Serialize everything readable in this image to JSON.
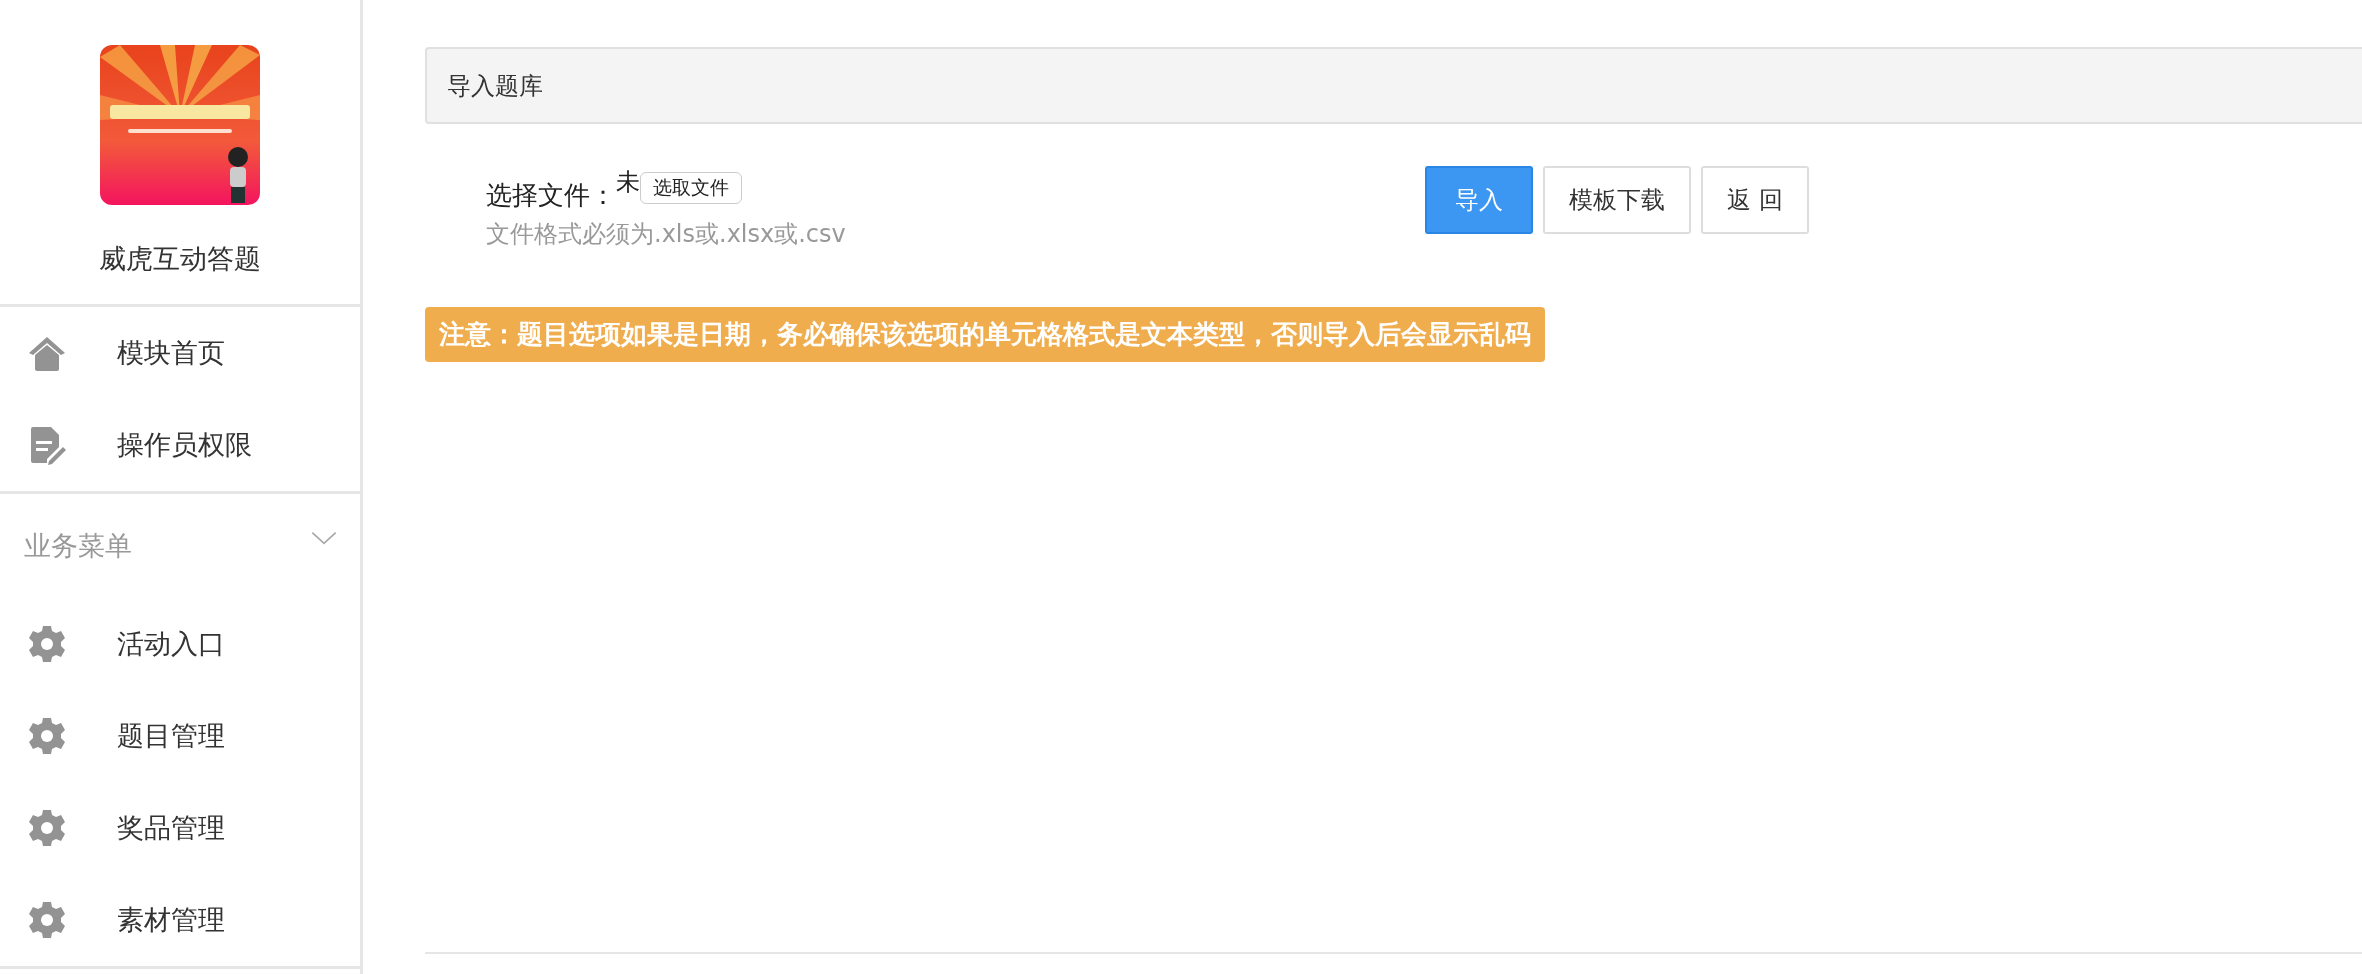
{
  "sidebar": {
    "app_name": "威虎互动答题",
    "top_items": [
      {
        "label": "模块首页"
      },
      {
        "label": "操作员权限"
      }
    ],
    "section": {
      "title": "业务菜单",
      "expanded": true
    },
    "items": [
      {
        "label": "活动入口"
      },
      {
        "label": "题目管理"
      },
      {
        "label": "奖品管理"
      },
      {
        "label": "素材管理"
      }
    ]
  },
  "panel_title": "导入题库",
  "form": {
    "label": "选择文件：",
    "file_status": "未",
    "choose_button": "选取文件",
    "hint": "文件格式必须为.xls或.xlsx或.csv"
  },
  "buttons": [
    {
      "label": "导入",
      "kind": "primary"
    },
    {
      "label": "模板下载",
      "kind": "default"
    },
    {
      "label": "返 回",
      "kind": "default"
    }
  ],
  "notice": "注意：题目选项如果是日期，务必确保该选项的单元格格式是文本类型，否则导入后会显示乱码"
}
